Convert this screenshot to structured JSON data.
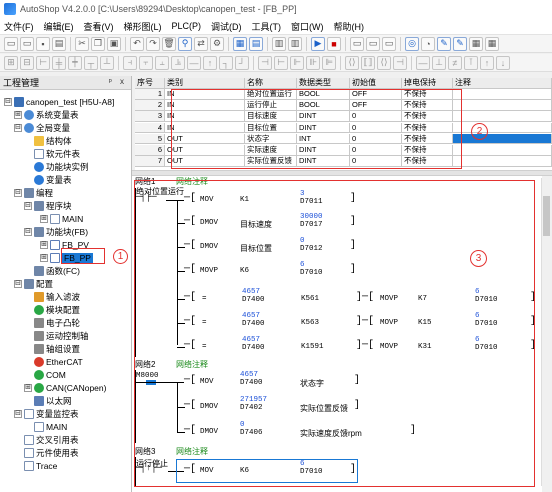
{
  "window": {
    "title": "AutoShop V4.2.0.0  [C:\\Users\\89294\\Desktop\\canopen_test - [FB_PP]"
  },
  "menu": [
    "文件(F)",
    "编辑(E)",
    "查看(V)",
    "梯形图(L)",
    "PLC(P)",
    "调试(D)",
    "工具(T)",
    "窗口(W)",
    "帮助(H)"
  ],
  "project_panel": {
    "title": "工程管理",
    "pin_icons": "ᵖ x",
    "tree": [
      {
        "label": "canopen_test [H5U-A8]",
        "icon": "pc",
        "exp": "⊟"
      },
      {
        "label": "系统变量表",
        "icon": "db",
        "exp": "⊞"
      },
      {
        "label": "全局变量",
        "icon": "db",
        "exp": "⊟"
      },
      {
        "label": "结构体",
        "icon": "struct"
      },
      {
        "label": "软元件表",
        "icon": "doc"
      },
      {
        "label": "功能块实例",
        "icon": "blue"
      },
      {
        "label": "变量表",
        "icon": "blue"
      },
      {
        "label": "编程",
        "icon": "grid",
        "exp": "⊟"
      },
      {
        "label": "程序块",
        "icon": "grid",
        "exp": "⊟"
      },
      {
        "label": "MAIN",
        "icon": "doc",
        "exp": "⊞"
      },
      {
        "label": "功能块(FB)",
        "icon": "grid",
        "exp": "⊟"
      },
      {
        "label": "FB_PV",
        "icon": "fb",
        "exp": "⊞"
      },
      {
        "label": "FB_PP",
        "icon": "fb",
        "exp": "⊞",
        "selected": true
      },
      {
        "label": "函数(FC)",
        "icon": "grid"
      },
      {
        "label": "配置",
        "icon": "grid",
        "exp": "⊟"
      },
      {
        "label": "输入滤波",
        "icon": "arrow"
      },
      {
        "label": "模块配置",
        "icon": "green"
      },
      {
        "label": "电子凸轮",
        "icon": "grey"
      },
      {
        "label": "运动控制轴",
        "icon": "grey"
      },
      {
        "label": "轴组设置",
        "icon": "grey"
      },
      {
        "label": "EtherCAT",
        "icon": "red"
      },
      {
        "label": "COM",
        "icon": "green"
      },
      {
        "label": "CAN(CANopen)",
        "icon": "green",
        "exp": "⊞"
      },
      {
        "label": "以太网",
        "icon": "net"
      },
      {
        "label": "变量监控表",
        "icon": "doc",
        "exp": "⊟"
      },
      {
        "label": "MAIN",
        "icon": "doc"
      },
      {
        "label": "交叉引用表",
        "icon": "doc"
      },
      {
        "label": "元件使用表",
        "icon": "doc"
      },
      {
        "label": "Trace",
        "icon": "doc"
      }
    ]
  },
  "var_table": {
    "headers": [
      "序号",
      "类别",
      "名称",
      "数据类型",
      "初始值",
      "掉电保持",
      "注释"
    ],
    "rows": [
      [
        "1",
        "IN",
        "绝对位置运行",
        "BOOL",
        "OFF",
        "不保持",
        ""
      ],
      [
        "2",
        "IN",
        "运行停止",
        "BOOL",
        "OFF",
        "不保持",
        ""
      ],
      [
        "3",
        "IN",
        "目标速度",
        "DINT",
        "0",
        "不保持",
        ""
      ],
      [
        "4",
        "IN",
        "目标位置",
        "DINT",
        "0",
        "不保持",
        ""
      ],
      [
        "5",
        "OUT",
        "状态字",
        "INT",
        "0",
        "不保持",
        ""
      ],
      [
        "6",
        "OUT",
        "实际速度",
        "DINT",
        "0",
        "不保持",
        ""
      ],
      [
        "7",
        "OUT",
        "实际位置反馈",
        "DINT",
        "0",
        "不保持",
        ""
      ]
    ]
  },
  "ladder": {
    "networks": [
      {
        "label": "网络1",
        "comment": "网络注释"
      },
      {
        "label": "网络2",
        "comment": "网络注释"
      },
      {
        "label": "网络3",
        "comment": "网络注释"
      }
    ],
    "n1_contact": "绝对位置运行",
    "n1_rows": [
      {
        "op": "MOV",
        "a1": "K1",
        "val": "3",
        "a2": "D7011"
      },
      {
        "op": "DMOV",
        "a1": "目标速度",
        "val": "30000",
        "a2": "D7017"
      },
      {
        "op": "DMOV",
        "a1": "目标位置",
        "val": "0",
        "a2": "D7012"
      },
      {
        "op": "MOVP",
        "a1": "K6",
        "val": "6",
        "a2": "D7010"
      }
    ],
    "n1_cmp": [
      {
        "cop": "=",
        "cval": "4657",
        "ca1": "D7400",
        "ca2": "K561",
        "op": "MOVP",
        "a1": "K7",
        "val": "6",
        "a2": "D7010"
      },
      {
        "cop": "=",
        "cval": "4657",
        "ca1": "D7400",
        "ca2": "K563",
        "op": "MOVP",
        "a1": "K15",
        "val": "6",
        "a2": "D7010"
      },
      {
        "cop": "=",
        "cval": "4657",
        "ca1": "D7400",
        "ca2": "K1591",
        "op": "MOVP",
        "a1": "K31",
        "val": "6",
        "a2": "D7010"
      }
    ],
    "n2_contact": "M8000",
    "n2_rows": [
      {
        "op": "MOV",
        "a1val": "4657",
        "a1": "D7400",
        "a2": "状态字"
      },
      {
        "op": "DMOV",
        "a1val": "271957",
        "a1": "D7402",
        "a2": "实际位置反馈"
      },
      {
        "op": "DMOV",
        "a1val": "0",
        "a1": "D7406",
        "a2": "实际速度反馈rpm"
      }
    ],
    "n3_contact": "运行停止",
    "n3_row": {
      "op": "MOV",
      "a1": "K6",
      "val": "6",
      "a2": "D7010"
    }
  },
  "annotations": {
    "c1": "1",
    "c2": "2",
    "c3": "3"
  },
  "colors": {
    "accent": "#1978d4",
    "annotation": "#e3312f",
    "comment": "#1a8a1a",
    "value": "#1a4fd8"
  }
}
